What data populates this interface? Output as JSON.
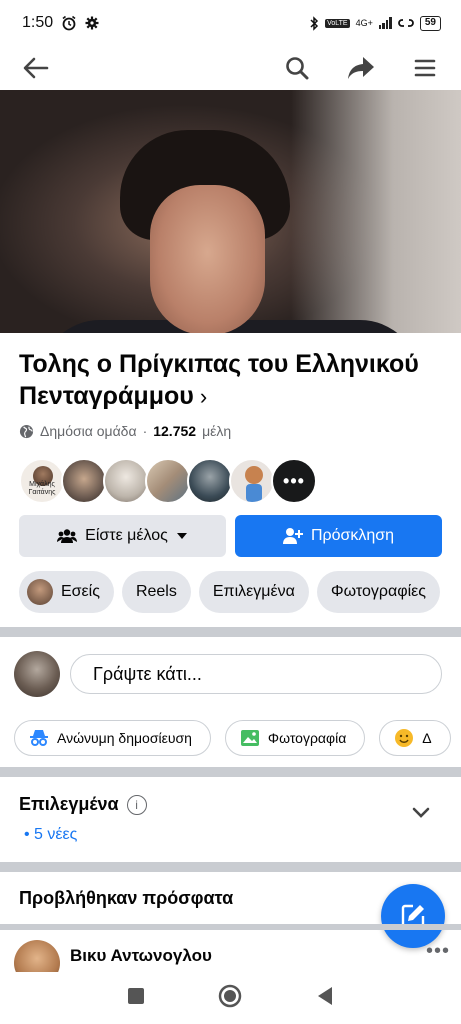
{
  "status_bar": {
    "time": "1:50",
    "network": "4G+",
    "battery": "59"
  },
  "cover": {
    "description_icon": "cover-photo"
  },
  "group": {
    "title": "Τολης ο Πρίγκιπας του Ελληνικού Πενταγράμμου",
    "chevron": "›",
    "privacy": "Δημόσια ομάδα",
    "separator": "·",
    "members_count": "12.752",
    "members_word": "μέλη"
  },
  "member_avatars": [
    {
      "caption": "Μιχάλης Γαιτάνης",
      "color": "#f1ece6"
    },
    {
      "caption": "",
      "color": "#6b5a50"
    },
    {
      "caption": "",
      "color": "#d8d2cb"
    },
    {
      "caption": "",
      "color": "#c8b7a4"
    },
    {
      "caption": "",
      "color": "#3b4b56"
    },
    {
      "caption": "",
      "color": "#e9e4e0"
    }
  ],
  "more_members": "•••",
  "actions": {
    "member_label": "Είστε μέλος",
    "invite_label": "Πρόσκληση"
  },
  "chips": [
    "Εσείς",
    "Reels",
    "Επιλεγμένα",
    "Φωτογραφίες"
  ],
  "composer": {
    "placeholder": "Γράψτε κάτι..."
  },
  "post_chips": [
    "Ανώνυμη δημοσίευση",
    "Φωτογραφία",
    "Δ"
  ],
  "featured": {
    "title": "Επιλεγμένα",
    "info": "i",
    "new": "• 5 νέες"
  },
  "recent": {
    "title": "Προβλήθηκαν πρόσφατα"
  },
  "post": {
    "author": "Βικυ Αντωνογλου",
    "more": "•••"
  },
  "colors": {
    "accent": "#1877f2",
    "chip_bg": "#e4e6eb",
    "divider": "#c9ccd1",
    "secondary_text": "#65676b"
  }
}
